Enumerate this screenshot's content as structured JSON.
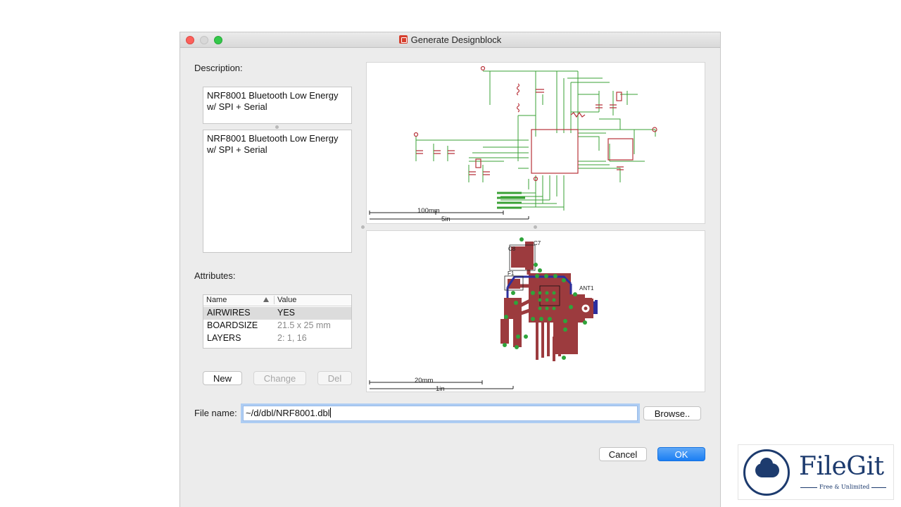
{
  "window": {
    "title": "Generate Designblock"
  },
  "description": {
    "label": "Description:",
    "summary": "NRF8001 Bluetooth Low Energy\nw/ SPI + Serial",
    "details": "NRF8001 Bluetooth Low Energy\nw/ SPI + Serial"
  },
  "attributes": {
    "label": "Attributes:",
    "columns": [
      "Name",
      "Value"
    ],
    "rows": [
      {
        "name": "AIRWIRES",
        "value": "YES"
      },
      {
        "name": "BOARDSIZE",
        "value": "21.5 x 25 mm"
      },
      {
        "name": "LAYERS",
        "value": "2: 1, 16"
      }
    ],
    "buttons": {
      "new": "New",
      "change": "Change",
      "del": "Del"
    }
  },
  "schematic_preview": {
    "scale_metric": "100mm",
    "scale_imperial": "5in"
  },
  "board_preview": {
    "scale_metric": "20mm",
    "scale_imperial": "1in",
    "labels": [
      "C8",
      "C7",
      "F1",
      "ANT1"
    ]
  },
  "file": {
    "label": "File name:",
    "value": "~/d/dbl/NRF8001.dbl",
    "browse": "Browse.."
  },
  "footer": {
    "cancel": "Cancel",
    "ok": "OK"
  },
  "watermark": {
    "brand": "FileGit",
    "tagline": "Free & Unlimited"
  },
  "colors": {
    "schematic_wire": "#3aa135",
    "schematic_part": "#b8323a",
    "pcb_copper": "#9c3b3e",
    "pcb_via": "#2fa43b",
    "pcb_bottom": "#2c2f9e",
    "accent": "#1a7ef3"
  }
}
